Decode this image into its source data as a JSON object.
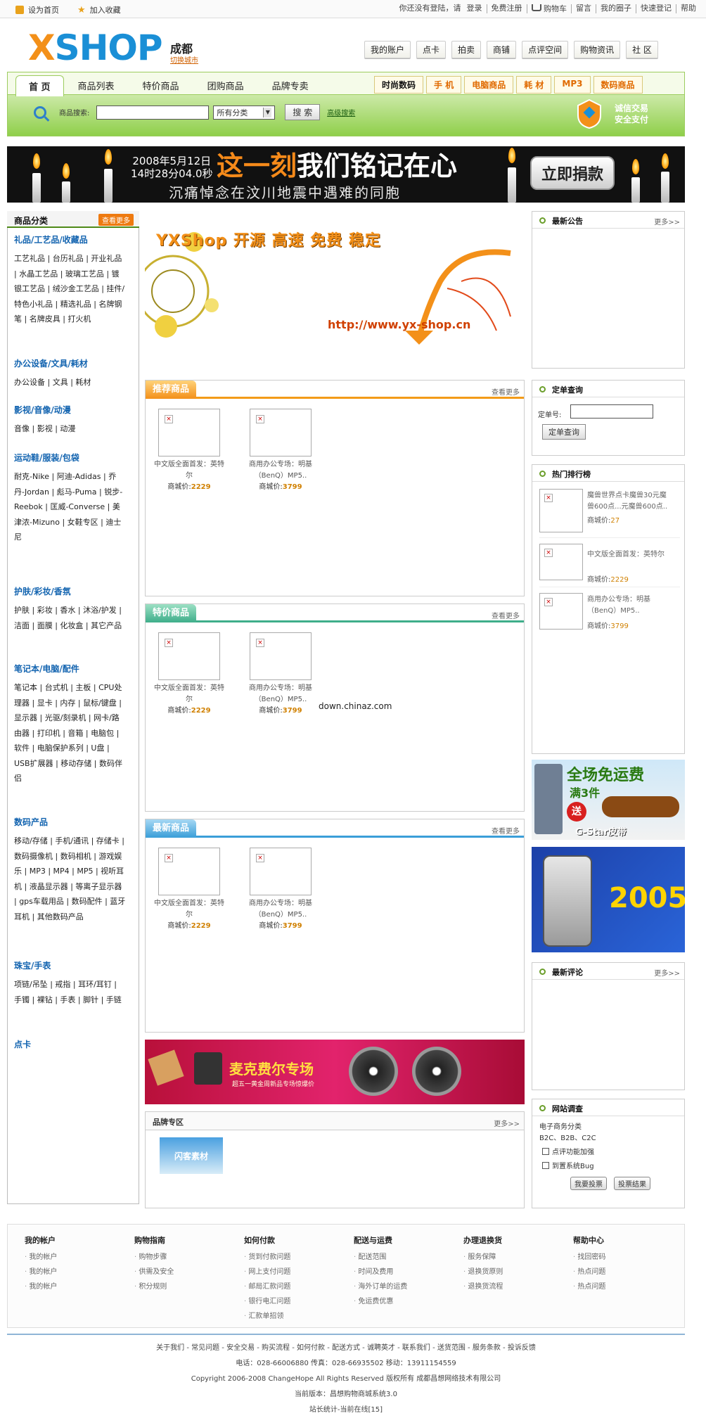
{
  "topbar": {
    "home": "设为首页",
    "favorite": "加入收藏",
    "welcome": "你还没有登陆，请",
    "login": "登录",
    "register": "免费注册",
    "cart": "购物车",
    "message": "留言",
    "myspace": "我的圈子",
    "lost": "快速登记",
    "help": "帮助"
  },
  "header": {
    "logo_x": "X",
    "logo_rest": "SHOP",
    "city": "成都",
    "city_switch": "切换城市",
    "nav": [
      "我的账户",
      "点卡",
      "拍卖",
      "商铺",
      "点评空间",
      "购物资讯",
      "社 区"
    ]
  },
  "mainnav": {
    "tabs": [
      "首 页",
      "商品列表",
      "特价商品",
      "团购商品",
      "品牌专卖"
    ],
    "cats": [
      "时尚数码",
      "手 机",
      "电脑商品",
      "耗 材",
      "MP3",
      "数码商品"
    ]
  },
  "search": {
    "label": "商品搜索:",
    "placeholder": "",
    "category": "所有分类",
    "button": "搜 索",
    "advanced": "高级搜索"
  },
  "trust": {
    "line1": "诚信交易",
    "line2": "安全支付"
  },
  "banner": {
    "date1": "2008年5月12日",
    "date2": "14时28分04.0秒",
    "title_a": "这一刻",
    "title_b": "我们铭记在心",
    "sub": "沉痛悼念在汶川地震中遇难的同胞",
    "donate": "立即捐款"
  },
  "left": {
    "title": "商品分类",
    "more": "查看更多",
    "sections": [
      {
        "h": "礼品/工艺品/收藏品",
        "b": "工艺礼品 | 台历礼品 | 开业礼品 | 水晶工艺品 | 玻璃工艺品 | 镀银工艺品 | 绒沙金工艺品 | 挂件/特色小礼品 | 精选礼品 | 名牌钢笔 | 名牌皮具 | 打火机"
      },
      {
        "h": "办公设备/文具/耗材",
        "b": "办公设备 | 文具 | 耗材"
      },
      {
        "h": "影视/音像/动漫",
        "b": "音像 | 影视 | 动漫"
      },
      {
        "h": "运动鞋/服装/包袋",
        "b": "耐克-Nike | 阿迪-Adidas | 乔丹-Jordan | 彪马-Puma | 锐步-Reebok | 匡威-Converse | 美津浓-Mizuno | 女鞋专区 | 迪士尼"
      },
      {
        "h": "护肤/彩妆/香氛",
        "b": "护肤 | 彩妆 | 香水 | 沐浴/护发 | 洁面 | 面膜 | 化妆盒 | 其它产品"
      },
      {
        "h": "笔记本/电脑/配件",
        "b": "笔记本 | 台式机 | 主板 | CPU处理器 | 显卡 | 内存 | 鼠标/键盘 | 显示器 | 光驱/刻录机 | 网卡/路由器 | 打印机 | 音箱 | 电脑包 | 软件 | 电脑保护系列 | U盘 | USB扩展器 | 移动存储 | 数码伴侣"
      },
      {
        "h": "数码产品",
        "b": "移动/存储 | 手机/通讯 | 存储卡 | 数码摄像机 | 数码相机 | 游戏娱乐 | MP3 | MP4 | MP5 | 视听耳机 | 液晶显示器 | 等离子显示器 | gps车载用品 | 数码配件 | 蓝牙耳机 | 其他数码产品"
      },
      {
        "h": "珠宝/手表",
        "b": "项链/吊坠 | 戒指 | 耳环/耳钉 | 手镯 | 裸钻 | 手表 | 脚针 | 手链"
      },
      {
        "h": "点卡",
        "b": ""
      }
    ]
  },
  "flash": {
    "title": "YXShop 开源 高速 免费 稳定",
    "url": "http://www.yx-shop.cn"
  },
  "sections": {
    "recommend": {
      "title": "推荐商品",
      "more": "查看更多"
    },
    "special": {
      "title": "特价商品",
      "more": "查看更多"
    },
    "newest": {
      "title": "最新商品",
      "more": "查看更多"
    },
    "brand": {
      "title": "品牌专区",
      "more": "更多>>"
    }
  },
  "products": [
    {
      "name": "中文版全面首发：英特尔",
      "price_label": "商城价:",
      "price": "2229"
    },
    {
      "name": "商用办公专场：明基（BenQ）MP5..",
      "price_label": "商城价:",
      "price": "3799"
    }
  ],
  "watermark": "down.chinaz.com",
  "brand_logo": "闪客素材",
  "adbanner": {
    "main": "麦克费尔专场",
    "sub": "超五一黄金周新品专场惊爆价"
  },
  "right": {
    "notice": {
      "title": "最新公告",
      "more": "更多>>"
    },
    "order": {
      "title": "定单查询",
      "label": "定单号:",
      "button": "定单查询"
    },
    "hot": {
      "title": "热门排行榜",
      "items": [
        {
          "name": "魔兽世界点卡魔兽30元魔兽600点...元魔兽600点..",
          "price_label": "商城价:",
          "price": "27"
        },
        {
          "name": "中文版全面首发：英特尔",
          "price_label": "商城价:",
          "price": "2229"
        },
        {
          "name": "商用办公专场：明基（BenQ）MP5..",
          "price_label": "商城价:",
          "price": "3799"
        }
      ]
    },
    "ad1": {
      "main": "全场免运费",
      "sub": "满3件",
      "brand": "G-Star皮带",
      "gift": "送"
    },
    "ad2": {
      "num": "2005"
    },
    "comment": {
      "title": "最新评论",
      "more": "更多>>"
    },
    "survey": {
      "title": "网站调查",
      "question": "电子商务分类",
      "sub": "B2C、B2B、C2C",
      "opt1": "点评功能加强",
      "opt2": "到置系统Bug",
      "vote": "我要投票",
      "view": "投票结果"
    }
  },
  "footer": {
    "cols": [
      {
        "h": "我的帐户",
        "items": [
          "我的帐户",
          "我的帐户",
          "我的帐户"
        ]
      },
      {
        "h": "购物指南",
        "items": [
          "购物步骤",
          "供需及安全",
          "积分规则"
        ]
      },
      {
        "h": "如何付款",
        "items": [
          "货到付款问题",
          "网上支付问题",
          "邮局汇款问题",
          "银行电汇问题",
          "汇款单招领"
        ]
      },
      {
        "h": "配送与运费",
        "items": [
          "配送范围",
          "时间及费用",
          "海外订单的运费",
          "免运费优惠"
        ]
      },
      {
        "h": "办理退换货",
        "items": [
          "服务保障",
          "退换货原则",
          "退换货流程"
        ]
      },
      {
        "h": "帮助中心",
        "items": [
          "找回密码",
          "热点问题",
          "热点问题"
        ]
      }
    ],
    "links": "关于我们 - 常见问题 - 安全交易 - 购买流程 - 如何付款 - 配送方式 - 诚聘英才 - 联系我们 - 送货范围 - 服务条款 - 投诉反馈",
    "contact": "电话：028-66006880 传真：028-66935502 移动：13911154559",
    "copyright": "Copyright 2006-2008 ChangeHope All Rights Reserved 版权所有 成都昌想网络技术有限公司",
    "version": "当前版本：昌想购物商城系统3.0",
    "stats": "站长统计-当前在线[15]"
  },
  "colors": {
    "accent": "#f39019",
    "brand": "#1a8fd6",
    "green": "#8fcf4a"
  }
}
